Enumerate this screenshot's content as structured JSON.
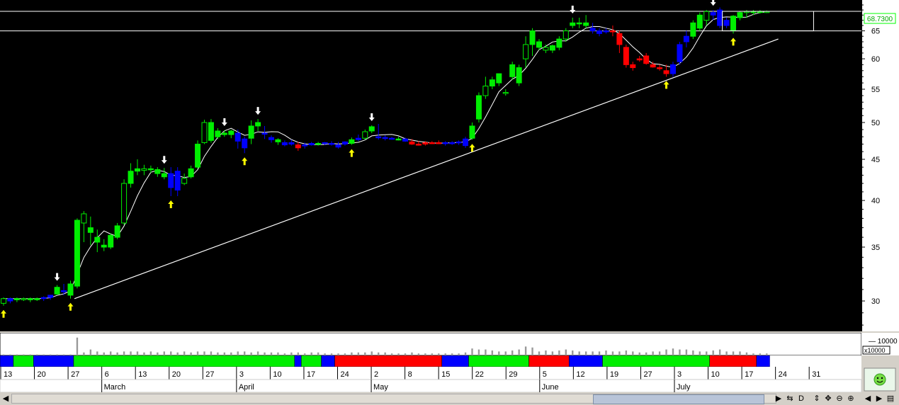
{
  "chart_data": {
    "type": "candlestick",
    "y_scale": "log",
    "ylim": [
      27.5,
      71
    ],
    "y_ticks": [
      30,
      35,
      40,
      45,
      50,
      55,
      60,
      65
    ],
    "last_price_label": "68.7300",
    "volume_axis_label": "10000",
    "volume_unit_label": "x10000",
    "support_levels": [
      68.73,
      65
    ],
    "trendline": {
      "start": [
        "27",
        30.2
      ],
      "end": [
        "24",
        63.5
      ]
    },
    "week_ticks": [
      "13",
      "20",
      "27",
      "6",
      "13",
      "20",
      "27",
      "3",
      "10",
      "17",
      "24",
      "2",
      "8",
      "15",
      "22",
      "29",
      "5",
      "12",
      "19",
      "27",
      "3",
      "10",
      "17",
      "24",
      "31"
    ],
    "months": [
      "March",
      "April",
      "May",
      "June",
      "July"
    ],
    "month_start_index": [
      3,
      7,
      11,
      16,
      20
    ],
    "ohlc": [
      [
        29.8,
        30.3,
        29.6,
        30.2
      ],
      [
        30.0,
        30.3,
        29.8,
        30.2
      ],
      [
        30.1,
        30.3,
        29.9,
        30.2
      ],
      [
        30.2,
        30.3,
        30.0,
        30.2
      ],
      [
        30.1,
        30.3,
        29.9,
        30.2
      ],
      [
        30.2,
        30.3,
        30.0,
        30.2
      ],
      [
        30.2,
        30.4,
        30.0,
        30.3
      ],
      [
        30.3,
        30.5,
        30.1,
        30.5
      ],
      [
        30.6,
        31.4,
        30.5,
        31.2
      ],
      [
        30.8,
        31.5,
        30.5,
        30.9
      ],
      [
        30.5,
        31.8,
        30.2,
        31.5
      ],
      [
        31.3,
        38.0,
        31.1,
        37.8
      ],
      [
        37.5,
        38.8,
        35.5,
        38.5
      ],
      [
        37.0,
        38.2,
        35.2,
        36.5
      ],
      [
        36.0,
        36.8,
        34.5,
        35.5
      ],
      [
        35.2,
        35.8,
        34.6,
        35.0
      ],
      [
        35.0,
        36.4,
        34.8,
        36.2
      ],
      [
        36.0,
        37.5,
        35.8,
        37.2
      ],
      [
        37.5,
        42.5,
        37.3,
        42.0
      ],
      [
        42.0,
        44.5,
        41.5,
        43.5
      ],
      [
        43.5,
        45.0,
        43.0,
        43.8
      ],
      [
        43.6,
        44.3,
        43.0,
        43.8
      ],
      [
        43.8,
        44.2,
        43.3,
        43.7
      ],
      [
        43.7,
        44.0,
        42.8,
        43.2
      ],
      [
        43.2,
        43.9,
        42.5,
        42.8
      ],
      [
        43.2,
        44.0,
        40.5,
        41.5
      ],
      [
        41.2,
        44.0,
        40.5,
        43.5
      ],
      [
        42.0,
        43.2,
        41.8,
        42.6
      ],
      [
        42.8,
        44.2,
        42.6,
        43.8
      ],
      [
        44.0,
        47.5,
        43.8,
        47.0
      ],
      [
        47.2,
        50.4,
        47.0,
        50.0
      ],
      [
        47.5,
        50.5,
        47.2,
        50.0
      ],
      [
        48.0,
        49.2,
        47.7,
        48.8
      ],
      [
        48.5,
        48.9,
        48.0,
        48.3
      ],
      [
        48.3,
        49.0,
        47.8,
        48.8
      ],
      [
        48.5,
        49.0,
        46.4,
        47.4
      ],
      [
        46.5,
        48.0,
        45.8,
        47.7
      ],
      [
        47.8,
        50.3,
        47.0,
        49.5
      ],
      [
        49.5,
        50.5,
        48.8,
        50.0
      ],
      [
        48.5,
        49.5,
        47.7,
        48.4
      ],
      [
        47.6,
        48.2,
        47.2,
        47.9
      ],
      [
        47.3,
        47.8,
        46.9,
        47.6
      ],
      [
        46.9,
        47.5,
        46.7,
        47.2
      ],
      [
        47.2,
        47.6,
        46.8,
        47.0
      ],
      [
        46.9,
        47.3,
        46.1,
        46.5
      ],
      [
        46.8,
        47.2,
        46.4,
        46.9
      ],
      [
        46.9,
        47.3,
        46.8,
        47.1
      ],
      [
        47.0,
        47.3,
        46.8,
        47.1
      ],
      [
        47.1,
        47.3,
        46.9,
        47.2
      ],
      [
        47.0,
        47.4,
        46.8,
        47.1
      ],
      [
        46.9,
        47.3,
        46.4,
        46.6
      ],
      [
        47.0,
        47.4,
        46.8,
        47.3
      ],
      [
        47.1,
        47.9,
        46.9,
        47.6
      ],
      [
        47.8,
        48.3,
        47.4,
        47.6
      ],
      [
        47.8,
        49.0,
        47.6,
        48.7
      ],
      [
        48.8,
        49.6,
        48.5,
        49.4
      ],
      [
        48.0,
        49.8,
        47.6,
        47.9
      ],
      [
        47.9,
        48.2,
        47.5,
        47.8
      ],
      [
        47.8,
        48.0,
        47.6,
        47.8
      ],
      [
        47.7,
        48.0,
        47.5,
        47.7
      ],
      [
        47.7,
        47.9,
        47.3,
        47.4
      ],
      [
        47.3,
        47.7,
        46.9,
        47.0
      ],
      [
        47.0,
        47.4,
        46.8,
        47.0
      ],
      [
        47.0,
        47.4,
        46.8,
        47.2
      ],
      [
        47.2,
        47.4,
        47.0,
        47.2
      ],
      [
        47.2,
        47.5,
        47.0,
        47.2
      ],
      [
        47.2,
        47.4,
        46.8,
        47.2
      ],
      [
        47.2,
        47.4,
        46.9,
        47.2
      ],
      [
        47.2,
        47.5,
        46.9,
        47.3
      ],
      [
        46.8,
        48.0,
        46.5,
        47.7
      ],
      [
        47.8,
        50.0,
        47.6,
        49.5
      ],
      [
        50.5,
        54.5,
        50.0,
        54.0
      ],
      [
        54.0,
        57.0,
        53.5,
        55.5
      ],
      [
        55.5,
        57.0,
        55.0,
        56.5
      ],
      [
        56.0,
        57.5,
        55.5,
        57.5
      ],
      [
        54.5,
        55.0,
        54.0,
        54.5
      ],
      [
        57.0,
        59.5,
        56.5,
        59.0
      ],
      [
        56.0,
        59.0,
        55.5,
        58.5
      ],
      [
        60.0,
        64.0,
        58.5,
        62.5
      ],
      [
        62.5,
        65.5,
        60.5,
        65.0
      ],
      [
        62.0,
        63.5,
        61.5,
        63.0
      ],
      [
        61.5,
        62.5,
        61.0,
        62.0
      ],
      [
        61.5,
        62.5,
        61.0,
        62.3
      ],
      [
        62.0,
        64.0,
        61.5,
        63.5
      ],
      [
        63.5,
        65.5,
        63.0,
        65.0
      ],
      [
        66.0,
        67.5,
        65.5,
        66.5
      ],
      [
        66.5,
        67.5,
        65.5,
        66.5
      ],
      [
        66.5,
        68.0,
        65.5,
        66.0
      ],
      [
        65.5,
        66.5,
        64.5,
        65.0
      ],
      [
        64.5,
        65.5,
        64.0,
        65.0
      ],
      [
        65.0,
        65.5,
        64.5,
        65.0
      ],
      [
        65.0,
        66.0,
        64.0,
        65.0
      ],
      [
        64.5,
        65.0,
        61.0,
        62.5
      ],
      [
        62.0,
        62.5,
        58.5,
        59.0
      ],
      [
        58.5,
        59.5,
        58.0,
        59.0
      ],
      [
        59.8,
        60.5,
        59.5,
        60.0
      ],
      [
        60.5,
        61.0,
        59.0,
        59.2
      ],
      [
        59.0,
        59.5,
        58.5,
        58.6
      ],
      [
        58.5,
        59.0,
        58.0,
        58.5
      ],
      [
        58.0,
        59.0,
        57.0,
        57.5
      ],
      [
        57.5,
        59.5,
        57.0,
        59.0
      ],
      [
        59.5,
        63.0,
        59.0,
        62.5
      ],
      [
        63.0,
        65.0,
        62.0,
        64.0
      ],
      [
        64.0,
        67.0,
        63.5,
        66.5
      ],
      [
        65.5,
        68.5,
        65.0,
        68.0
      ],
      [
        67.0,
        69.0,
        66.0,
        68.7
      ],
      [
        68.0,
        69.0,
        67.0,
        68.5
      ],
      [
        69.0,
        69.5,
        65.5,
        66.0
      ],
      [
        66.0,
        67.5,
        65.5,
        67.0
      ],
      [
        65.0,
        68.0,
        64.5,
        67.8
      ],
      [
        67.5,
        68.8,
        67.0,
        68.5
      ],
      [
        68.5,
        69.0,
        67.5,
        68.7
      ],
      [
        68.7,
        69.0,
        68.0,
        68.7
      ],
      [
        68.7,
        69.0,
        68.3,
        68.7
      ],
      [
        68.7,
        68.9,
        68.4,
        68.7
      ]
    ],
    "candle_colors": [
      "g",
      "b",
      "g",
      "g",
      "g",
      "g",
      "b",
      "b",
      "g",
      "b",
      "g",
      "g",
      "g",
      "g",
      "g",
      "g",
      "g",
      "g",
      "g",
      "g",
      "g",
      "g",
      "g",
      "g",
      "g",
      "b",
      "b",
      "g",
      "g",
      "g",
      "g",
      "g",
      "g",
      "g",
      "g",
      "b",
      "b",
      "g",
      "g",
      "b",
      "b",
      "g",
      "b",
      "b",
      "r",
      "b",
      "b",
      "g",
      "b",
      "b",
      "b",
      "b",
      "g",
      "b",
      "g",
      "g",
      "b",
      "b",
      "b",
      "g",
      "b",
      "r",
      "r",
      "r",
      "r",
      "r",
      "b",
      "b",
      "b",
      "b",
      "g",
      "g",
      "g",
      "g",
      "g",
      "g",
      "g",
      "g",
      "g",
      "g",
      "g",
      "g",
      "g",
      "g",
      "g",
      "g",
      "g",
      "g",
      "b",
      "b",
      "b",
      "r",
      "r",
      "r",
      "r",
      "r",
      "r",
      "r",
      "r",
      "r",
      "b",
      "b",
      "b",
      "g",
      "g",
      "g",
      "b",
      "b",
      "b",
      "g",
      "g",
      "g",
      "g",
      "g",
      "g"
    ],
    "buy_signals": [
      0,
      10,
      25,
      36,
      52,
      70,
      99,
      109
    ],
    "sell_signals": [
      8,
      24,
      33,
      38,
      55,
      85,
      106
    ],
    "volume": [
      0.05,
      0.05,
      0.05,
      0.05,
      0.05,
      0.05,
      0.05,
      0.05,
      0.05,
      0.05,
      0.05,
      0.9,
      0.15,
      0.3,
      0.2,
      0.15,
      0.2,
      0.15,
      0.2,
      0.2,
      0.2,
      0.15,
      0.2,
      0.15,
      0.2,
      0.2,
      0.15,
      0.2,
      0.15,
      0.2,
      0.2,
      0.2,
      0.15,
      0.15,
      0.15,
      0.2,
      0.2,
      0.15,
      0.2,
      0.15,
      0.15,
      0.15,
      0.1,
      0.15,
      0.15,
      0.1,
      0.15,
      0.15,
      0.1,
      0.1,
      0.1,
      0.1,
      0.15,
      0.15,
      0.15,
      0.2,
      0.15,
      0.15,
      0.1,
      0.1,
      0.1,
      0.15,
      0.1,
      0.1,
      0.1,
      0.1,
      0.1,
      0.1,
      0.1,
      0.15,
      0.35,
      0.3,
      0.3,
      0.25,
      0.2,
      0.2,
      0.25,
      0.3,
      0.45,
      0.4,
      0.2,
      0.25,
      0.2,
      0.25,
      0.3,
      0.25,
      0.2,
      0.2,
      0.2,
      0.2,
      0.25,
      0.2,
      0.2,
      0.25,
      0.2,
      0.15,
      0.15,
      0.2,
      0.2,
      0.3,
      0.35,
      0.3,
      0.3,
      0.25,
      0.2,
      0.2,
      0.25,
      0.3,
      0.2,
      0.2,
      0.2,
      0.15,
      0.1,
      0.1,
      0.1
    ],
    "trend_bar": [
      {
        "to": 2,
        "c": "b"
      },
      {
        "to": 5,
        "c": "g"
      },
      {
        "to": 11,
        "c": "b"
      },
      {
        "to": 44,
        "c": "g"
      },
      {
        "to": 45,
        "c": "b"
      },
      {
        "to": 48,
        "c": "g"
      },
      {
        "to": 50,
        "c": "b"
      },
      {
        "to": 66,
        "c": "r"
      },
      {
        "to": 70,
        "c": "b"
      },
      {
        "to": 79,
        "c": "g"
      },
      {
        "to": 85,
        "c": "r"
      },
      {
        "to": 90,
        "c": "b"
      },
      {
        "to": 106,
        "c": "g"
      },
      {
        "to": 113,
        "c": "r"
      },
      {
        "to": 115,
        "c": "b"
      },
      {
        "to": 135,
        "c": "g"
      }
    ]
  },
  "colors": {
    "background": "#000000",
    "bull": "#00ee00",
    "bear": "#ff0000",
    "neutral": "#0000ff",
    "ma": "#ffffff",
    "buy_arrow": "#ffff00",
    "sell_arrow": "#ffffff",
    "last_price": "#00ff00"
  },
  "toolbar_icons": [
    "sync-icon",
    "d-label",
    "move-icon",
    "pan-icon",
    "zoom-out-icon",
    "zoom-in-icon",
    "prev-icon",
    "next-icon",
    "panel-icon"
  ],
  "toolbar_labels": {
    "d": "D"
  }
}
